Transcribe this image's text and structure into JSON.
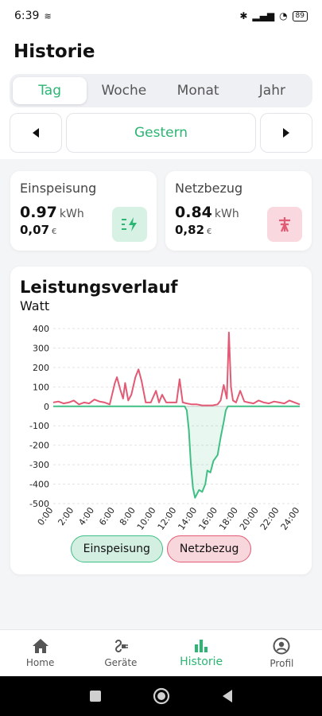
{
  "status": {
    "time": "6:39",
    "battery": "89"
  },
  "page_title": "Historie",
  "tabs": [
    {
      "label": "Tag",
      "active": true
    },
    {
      "label": "Woche",
      "active": false
    },
    {
      "label": "Monat",
      "active": false
    },
    {
      "label": "Jahr",
      "active": false
    }
  ],
  "date_nav": {
    "current": "Gestern",
    "prev_icon": "triangle-left-icon",
    "next_icon": "triangle-right-icon"
  },
  "cards": {
    "feed": {
      "title": "Einspeisung",
      "kwh": "0.97",
      "kwh_unit": "kWh",
      "cost": "0,07",
      "cost_unit": "€",
      "icon": "feed-in-icon",
      "color": "#2bb673"
    },
    "grid": {
      "title": "Netzbezug",
      "kwh": "0.84",
      "kwh_unit": "kWh",
      "cost": "0,82",
      "cost_unit": "€",
      "icon": "grid-pylon-icon",
      "color": "#e35a74"
    }
  },
  "chart_data": {
    "type": "line",
    "title": "Leistungsverlauf",
    "ylabel": "Watt",
    "xlabel": "",
    "ylim": [
      -500,
      400
    ],
    "xlim": [
      0,
      24
    ],
    "yticks": [
      "400",
      "300",
      "200",
      "100",
      "0",
      "-100",
      "-200",
      "-300",
      "-400",
      "-500"
    ],
    "xticks": [
      "0:00",
      "2:00",
      "4:00",
      "6:00",
      "8:00",
      "10:00",
      "12:00",
      "14:00",
      "16:00",
      "18:00",
      "20:00",
      "22:00",
      "24:00"
    ],
    "grid": true,
    "series": [
      {
        "name": "Netzbezug",
        "color": "#e35a74",
        "x": [
          0,
          0.5,
          1,
          1.5,
          2,
          2.5,
          3,
          3.5,
          4,
          4.5,
          5,
          5.5,
          6,
          6.2,
          6.5,
          6.8,
          7,
          7.3,
          7.6,
          8,
          8.3,
          8.6,
          9,
          9.5,
          10,
          10.3,
          10.6,
          11,
          11.5,
          12,
          12.3,
          12.6,
          13,
          13.5,
          14,
          14.5,
          15,
          15.5,
          16,
          16.3,
          16.6,
          16.9,
          17.1,
          17.3,
          17.5,
          17.8,
          18.2,
          18.6,
          19,
          19.5,
          20,
          20.5,
          21,
          21.5,
          22,
          22.5,
          23,
          23.5,
          24
        ],
        "values": [
          20,
          25,
          15,
          20,
          30,
          10,
          20,
          15,
          35,
          25,
          20,
          10,
          120,
          150,
          90,
          40,
          120,
          30,
          60,
          150,
          190,
          130,
          20,
          20,
          80,
          20,
          60,
          20,
          20,
          20,
          140,
          20,
          15,
          10,
          10,
          5,
          5,
          5,
          10,
          30,
          110,
          40,
          380,
          100,
          30,
          20,
          80,
          25,
          20,
          15,
          30,
          20,
          15,
          25,
          20,
          15,
          30,
          20,
          10
        ]
      },
      {
        "name": "Einspeisung",
        "color": "#3fbf84",
        "x": [
          0,
          12.8,
          13,
          13.2,
          13.4,
          13.6,
          13.8,
          14,
          14.2,
          14.5,
          14.8,
          15,
          15.3,
          15.6,
          16,
          16.3,
          16.6,
          16.8,
          17,
          24
        ],
        "values": [
          0,
          0,
          -20,
          -120,
          -300,
          -420,
          -470,
          -450,
          -430,
          -440,
          -400,
          -330,
          -340,
          -280,
          -250,
          -160,
          -80,
          -20,
          0,
          0
        ]
      }
    ]
  },
  "legend": {
    "feed": "Einspeisung",
    "grid": "Netzbezug"
  },
  "bottom_nav": [
    {
      "label": "Home",
      "icon": "home-icon",
      "active": false
    },
    {
      "label": "Geräte",
      "icon": "plug-icon",
      "active": false
    },
    {
      "label": "Historie",
      "icon": "bar-chart-icon",
      "active": true
    },
    {
      "label": "Profil",
      "icon": "profile-icon",
      "active": false
    }
  ]
}
